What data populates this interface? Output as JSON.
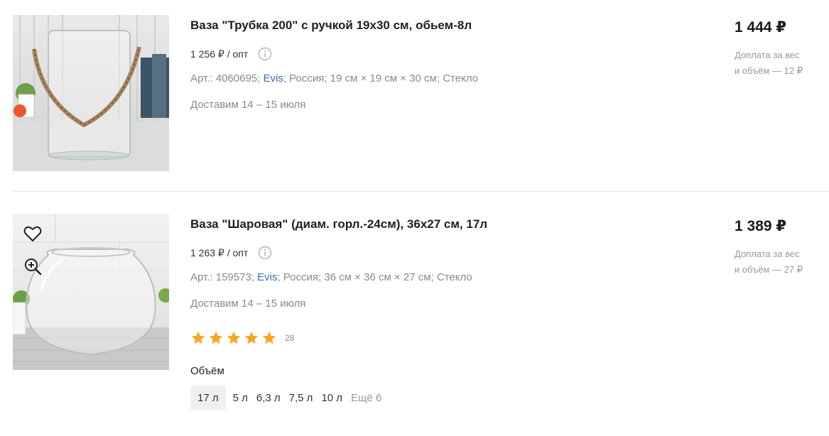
{
  "products": [
    {
      "title": "Ваза \"Трубка 200\" с ручкой 19х30 см, обьем-8л",
      "unit_price": "1 256 ₽ / опт",
      "specs": {
        "article": "Арт.: 4060695;",
        "brand": "Evis",
        "sep1": ";",
        "country": "Россия;",
        "size": "19 см × 19 см × 30 см;",
        "material": "Стекло"
      },
      "delivery": "Доставим 14 – 15 июля",
      "price": "1 444 ₽",
      "surcharge_line1": "Доплата за вес",
      "surcharge_line2": "и объём — 12 ₽",
      "image_icon": "vase-with-rope-handle"
    },
    {
      "title": "Ваза \"Шаровая\" (диам. горл.-24см), 36х27 см, 17л",
      "unit_price": "1 263 ₽ / опт",
      "specs": {
        "article": "Арт.: 159573;",
        "brand": "Evis",
        "sep1": ";",
        "country": "Россия;",
        "size": "36 см × 36 см × 27 см;",
        "material": "Стекло"
      },
      "delivery": "Доставим 14 – 15 июля",
      "rating": {
        "stars": 5,
        "count": "28"
      },
      "volume_label": "Объём",
      "volume_options": [
        "17 л",
        "5 л",
        "6,3 л",
        "7,5 л",
        "10 л"
      ],
      "volume_selected": "17 л",
      "volume_more": "Ещё 6",
      "price": "1 389 ₽",
      "surcharge_line1": "Доплата за вес",
      "surcharge_line2": "и объём — 27 ₽",
      "image_icon": "round-glass-bowl-vase",
      "overlay_icons": [
        "heart-icon",
        "zoom-in-icon"
      ]
    }
  ],
  "colors": {
    "brand_link": "#3b6bb5",
    "star": "#f5a623",
    "muted": "#8a8a8a",
    "price": "#1a1a1a"
  }
}
